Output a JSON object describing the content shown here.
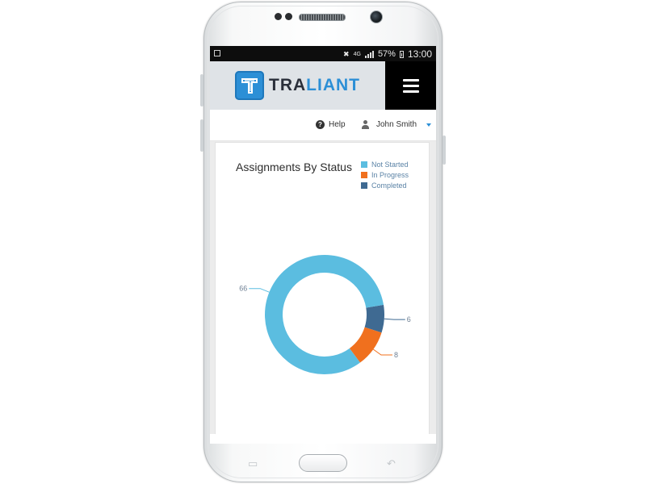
{
  "status_bar": {
    "battery_percent": "57%",
    "time": "13:00",
    "network": "4G"
  },
  "header": {
    "logo_prefix": "TRA",
    "logo_suffix": "LIANT"
  },
  "user_bar": {
    "help_label": "Help",
    "user_name": "John Smith"
  },
  "colors": {
    "not_started": "#5bbde0",
    "in_progress": "#f0701e",
    "completed": "#3f6a92"
  },
  "chart_data": {
    "type": "pie",
    "title": "Assignments By Status",
    "legend_position": "top-right",
    "series": [
      {
        "name": "Not Started",
        "value": 66
      },
      {
        "name": "In Progress",
        "value": 8
      },
      {
        "name": "Completed",
        "value": 6
      }
    ]
  }
}
